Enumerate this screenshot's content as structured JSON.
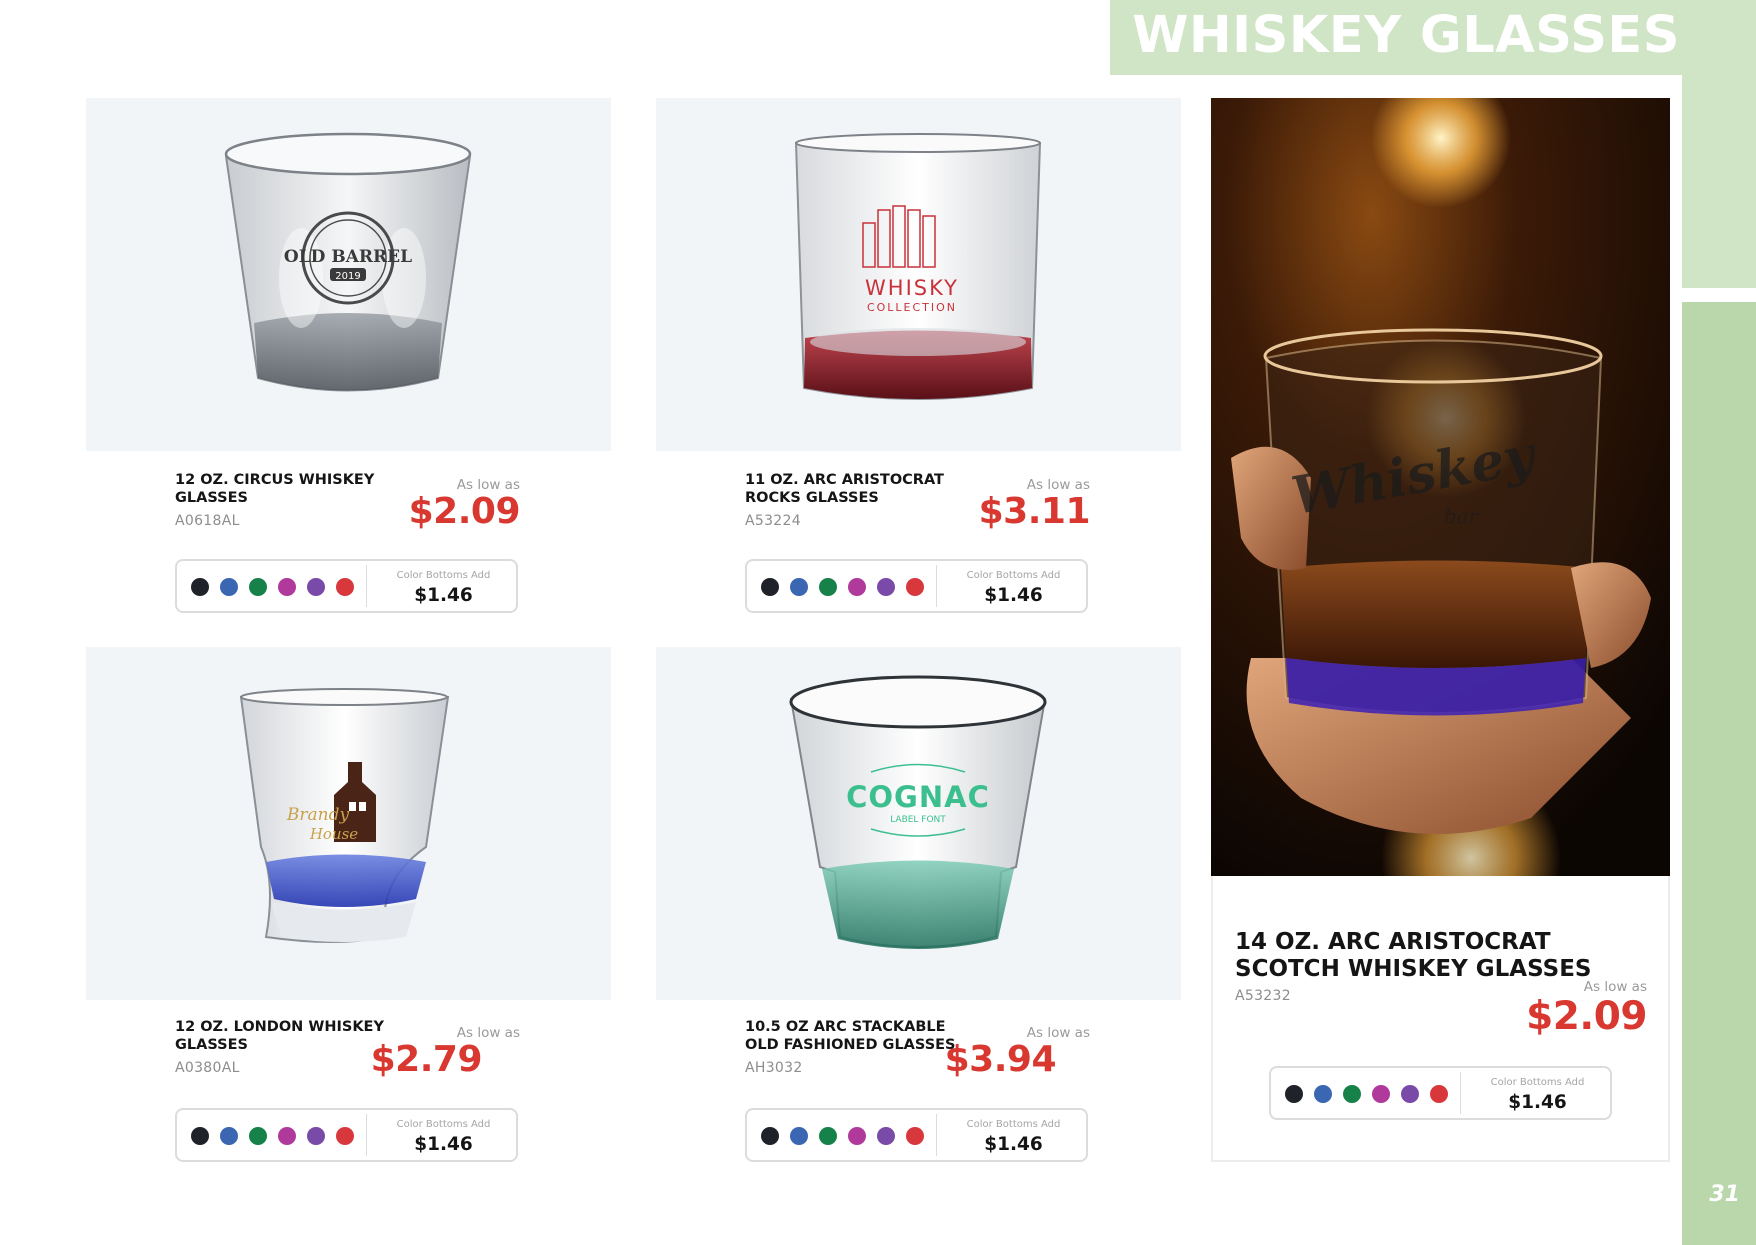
{
  "page": {
    "title": "WHISKEY GLASSES",
    "page_number": "31"
  },
  "colors": {
    "accent_light": "#cfe5c6",
    "accent_dark": "#b9d7ab",
    "price_red": "#d8382f"
  },
  "swatches": [
    "#1f2228",
    "#3b66b2",
    "#17814a",
    "#b03a9b",
    "#7a4aa8",
    "#d8383c"
  ],
  "products": [
    {
      "name": "12 OZ. CIRCUS WHISKEY GLASSES",
      "sku": "A0618AL",
      "as_low_as": "As low as",
      "price": "$2.09",
      "color_bottoms_label": "Color Bottoms Add",
      "color_bottoms_price": "$1.46",
      "imprint": "OLD BARREL",
      "imprint_year": "2019"
    },
    {
      "name": "11 OZ. ARC ARISTOCRAT ROCKS GLASSES",
      "sku": "A53224",
      "as_low_as": "As low as",
      "price": "$3.11",
      "color_bottoms_label": "Color Bottoms Add",
      "color_bottoms_price": "$1.46",
      "imprint": "WHISKY",
      "imprint_sub": "COLLECTION"
    },
    {
      "name": "12 OZ. LONDON WHISKEY GLASSES",
      "sku": "A0380AL",
      "as_low_as": "As low as",
      "price": "$2.79",
      "color_bottoms_label": "Color Bottoms Add",
      "color_bottoms_price": "$1.46",
      "imprint": "Brandy",
      "imprint_sub": "House"
    },
    {
      "name": "10.5 OZ ARC STACKABLE OLD FASHIONED GLASSES",
      "sku": "AH3032",
      "as_low_as": "As low as",
      "price": "$3.94",
      "color_bottoms_label": "Color Bottoms Add",
      "color_bottoms_price": "$1.46",
      "imprint": "COGNAC",
      "imprint_sub": "LABEL FONT"
    }
  ],
  "featured": {
    "name": "14 OZ. ARC ARISTOCRAT SCOTCH WHISKEY GLASSES",
    "sku": "A53232",
    "as_low_as": "As low as",
    "price": "$2.09",
    "color_bottoms_label": "Color Bottoms Add",
    "color_bottoms_price": "$1.46",
    "imprint": "Whiskey",
    "imprint_sub": "bar"
  }
}
